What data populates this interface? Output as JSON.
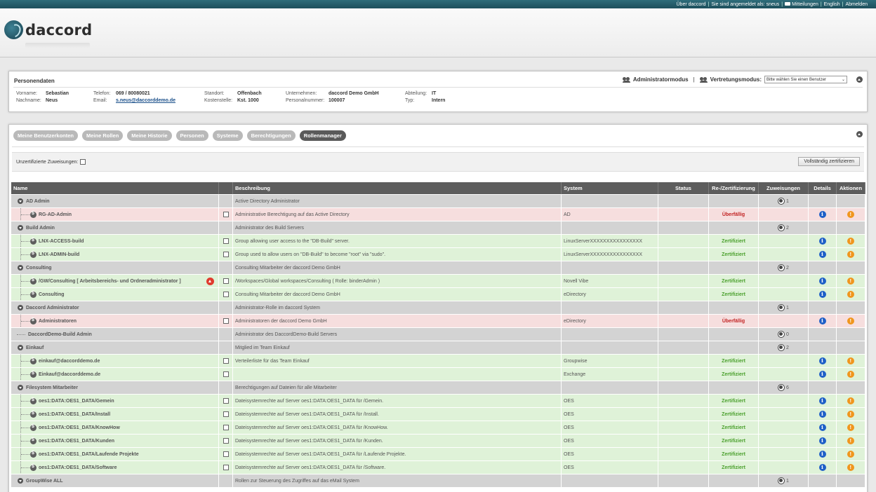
{
  "topbar": {
    "about": "Über daccord",
    "logged_in": "Sie sind angemeldet als: sneus",
    "messages": "Mitteilungen",
    "language": "English",
    "logout": "Abmelden"
  },
  "brand": {
    "name": "daccord"
  },
  "person": {
    "title": "Personendaten",
    "admin_mode": "Administratormodus",
    "deputy_mode": "Vertretungsmodus:",
    "deputy_select": "Bitte wählen Sie einen Benutzer",
    "fields": {
      "vorname_l": "Vorname:",
      "vorname": "Sebastian",
      "nachname_l": "Nachname:",
      "nachname": "Neus",
      "telefon_l": "Telefon:",
      "telefon": "069 / 80080021",
      "email_l": "Email:",
      "email": "s.neus@daccorddemo.de",
      "standort_l": "Standort:",
      "standort": "Offenbach",
      "kostenstelle_l": "Kostenstelle:",
      "kostenstelle": "Kst. 1000",
      "unternehmen_l": "Unternehmen:",
      "unternehmen": "daccord Demo GmbH",
      "personalnummer_l": "Personalnummer:",
      "personalnummer": "100007",
      "abteilung_l": "Abteilung:",
      "abteilung": "IT",
      "typ_l": "Typ:",
      "typ": "Intern"
    }
  },
  "tabs": [
    "Meine Benutzerkonten",
    "Meine Rollen",
    "Meine Historie",
    "Personen",
    "Systeme",
    "Berechtigungen",
    "Rollenmanager"
  ],
  "active_tab": 6,
  "filter": {
    "uncertified_label": "Unzertifizierte Zuweisungen:",
    "certify_all_button": "Vollständig zertifizieren"
  },
  "table": {
    "headers": {
      "name": "Name",
      "desc": "Beschreibung",
      "system": "System",
      "status": "Status",
      "cert": "Re-/Zertifizierung",
      "assign": "Zuweisungen",
      "details": "Details",
      "actions": "Aktionen"
    },
    "rows": [
      {
        "kind": "group",
        "name": "AD Admin",
        "desc": "Active Directory Administrator",
        "assign": "1"
      },
      {
        "kind": "red",
        "name": "RG-AD-Admin",
        "desc": "Administrative Berechtigung auf das Active Directory",
        "system": "AD",
        "cert": "Überfällig"
      },
      {
        "kind": "group",
        "name": "Build Admin",
        "desc": "Administrator des Build Servers",
        "assign": "2"
      },
      {
        "kind": "green",
        "name": "LNX-ACCESS-build",
        "desc": "Group allowing user access to the \"DB-Build\" server.",
        "system": "LinuxServerXXXXXXXXXXXXXXXX",
        "cert": "Zertifiziert"
      },
      {
        "kind": "green",
        "name": "LNX-ADMIN-build",
        "desc": "Group used to allow users on \"DB-Build\" to become \"root\" via \"sudo\".",
        "system": "LinuxServerXXXXXXXXXXXXXXXX",
        "cert": "Zertifiziert"
      },
      {
        "kind": "group",
        "name": "Consulting",
        "desc": "Consulting Mitarbeiter der daccord Demo GmbH",
        "assign": "2"
      },
      {
        "kind": "green",
        "name": "/GW/Consulting [ Arbeitsbereichs- und Ordneradministrator ]",
        "desc": "/Workspaces/Global workspaces/Consulting ( Rolle: binderAdmin )",
        "system": "Novell Vibe",
        "cert": "Zertifiziert",
        "warn": true
      },
      {
        "kind": "green",
        "name": "Consulting",
        "desc": "Consulting Mitarbeiter der daccord Demo GmbH",
        "system": "eDirectory",
        "cert": "Zertifiziert"
      },
      {
        "kind": "group",
        "name": "Daccord Administrator",
        "desc": "Administrator-Rolle im daccord System",
        "assign": "1"
      },
      {
        "kind": "red",
        "name": "Administratoren",
        "desc": "Administratoren der daccord Demo GmbH",
        "system": "eDirectory",
        "cert": "Überfällig"
      },
      {
        "kind": "group",
        "name": "DaccordDemo-Build Admin",
        "desc": "Administrator des DaccordDemo-Build Servers",
        "assign": "0",
        "noexp": true
      },
      {
        "kind": "group",
        "name": "Einkauf",
        "desc": "Mitglied im Team Einkauf",
        "assign": "2"
      },
      {
        "kind": "green",
        "name": "einkauf@daccorddemo.de",
        "desc": "Verteilerliste für das Team Einkauf",
        "system": "Groupwise",
        "cert": "Zertifiziert"
      },
      {
        "kind": "green",
        "name": "Einkauf@daccorddemo.de",
        "desc": "",
        "system": "Exchange",
        "cert": "Zertifiziert"
      },
      {
        "kind": "group",
        "name": "Filesystem Mitarbeiter",
        "desc": "Berechtigungen auf Dateien für alle Mitarbeiter",
        "assign": "6"
      },
      {
        "kind": "green",
        "name": "oes1:DATA:OES1_DATA/Gemein",
        "desc": "Dateisystemrechte auf Server oes1:DATA:OES1_DATA für /Gemein.",
        "system": "OES",
        "cert": "Zertifiziert"
      },
      {
        "kind": "green",
        "name": "oes1:DATA:OES1_DATA/Install",
        "desc": "Dateisystemrechte auf Server oes1:DATA:OES1_DATA für /Install.",
        "system": "OES",
        "cert": "Zertifiziert"
      },
      {
        "kind": "green",
        "name": "oes1:DATA:OES1_DATA/KnowHow",
        "desc": "Dateisystemrechte auf Server oes1:DATA:OES1_DATA für /KnowHow.",
        "system": "OES",
        "cert": "Zertifiziert"
      },
      {
        "kind": "green",
        "name": "oes1:DATA:OES1_DATA/Kunden",
        "desc": "Dateisystemrechte auf Server oes1:DATA:OES1_DATA für /Kunden.",
        "system": "OES",
        "cert": "Zertifiziert"
      },
      {
        "kind": "green",
        "name": "oes1:DATA:OES1_DATA/Laufende Projekte",
        "desc": "Dateisystemrechte auf Server oes1:DATA:OES1_DATA für /Laufende Projekte.",
        "system": "OES",
        "cert": "Zertifiziert"
      },
      {
        "kind": "green",
        "name": "oes1:DATA:OES1_DATA/Software",
        "desc": "Dateisystemrechte auf Server oes1:DATA:OES1_DATA für /Software.",
        "system": "OES",
        "cert": "Zertifiziert"
      },
      {
        "kind": "group",
        "name": "GroupWise ALL",
        "desc": "Rollen zur Steuerung des Zugriffes auf das eMail System",
        "assign": "1"
      }
    ]
  }
}
